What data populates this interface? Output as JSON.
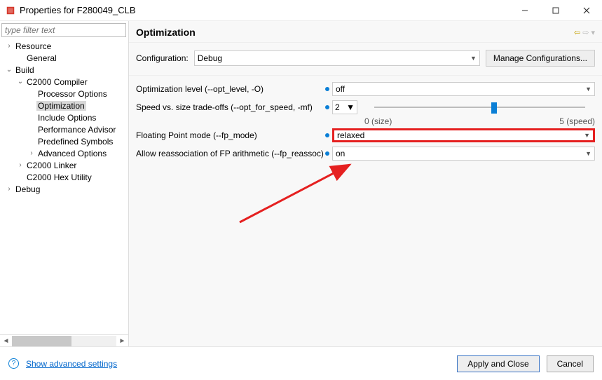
{
  "window": {
    "title": "Properties for F280049_CLB"
  },
  "sidebar": {
    "filter_placeholder": "type filter text",
    "items": [
      {
        "label": "Resource",
        "indent": 0,
        "tw": "›"
      },
      {
        "label": "General",
        "indent": 1,
        "tw": ""
      },
      {
        "label": "Build",
        "indent": 0,
        "tw": "⌄"
      },
      {
        "label": "C2000 Compiler",
        "indent": 1,
        "tw": "⌄"
      },
      {
        "label": "Processor Options",
        "indent": 2,
        "tw": ""
      },
      {
        "label": "Optimization",
        "indent": 2,
        "tw": "",
        "sel": true
      },
      {
        "label": "Include Options",
        "indent": 2,
        "tw": ""
      },
      {
        "label": "Performance Advisor",
        "indent": 2,
        "tw": ""
      },
      {
        "label": "Predefined Symbols",
        "indent": 2,
        "tw": ""
      },
      {
        "label": "Advanced Options",
        "indent": 2,
        "tw": "›"
      },
      {
        "label": "C2000 Linker",
        "indent": 1,
        "tw": "›"
      },
      {
        "label": "C2000 Hex Utility",
        "indent": 1,
        "tw": ""
      },
      {
        "label": "Debug",
        "indent": 0,
        "tw": "›"
      }
    ]
  },
  "main": {
    "heading": "Optimization",
    "config_label": "Configuration:",
    "config_value": "Debug",
    "manage_label": "Manage Configurations...",
    "rows": {
      "opt_level": {
        "label": "Optimization level (--opt_level, -O)",
        "value": "off"
      },
      "speed_size": {
        "label": "Speed vs. size trade-offs (--opt_for_speed, -mf)",
        "value": "2",
        "min_label": "0 (size)",
        "max_label": "5 (speed)"
      },
      "fp_mode": {
        "label": "Floating Point mode (--fp_mode)",
        "value": "relaxed"
      },
      "fp_reassoc": {
        "label": "Allow reassociation of FP arithmetic (--fp_reassoc)",
        "value": "on"
      }
    }
  },
  "footer": {
    "advanced": "Show advanced settings",
    "apply": "Apply and Close",
    "cancel": "Cancel"
  }
}
